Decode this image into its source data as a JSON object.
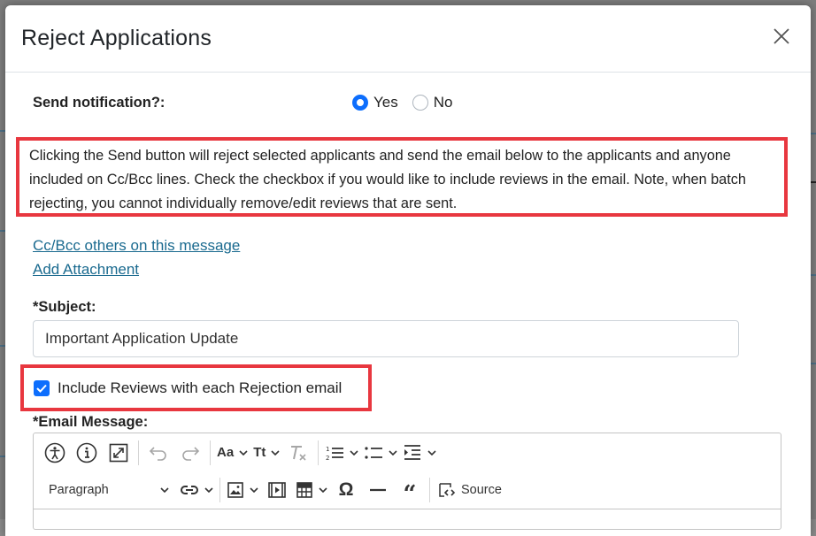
{
  "dialog": {
    "title": "Reject Applications"
  },
  "notification": {
    "label": "Send notification?:",
    "options": [
      {
        "label": "Yes",
        "checked": true
      },
      {
        "label": "No",
        "checked": false
      }
    ]
  },
  "info_text": "Clicking the Send button will reject selected applicants and send the email below to the applicants and anyone included on Cc/Bcc lines. Check the checkbox if you would like to include reviews in the email. Note, when batch rejecting, you cannot individually remove/edit reviews that are sent.",
  "links": {
    "cc_bcc": "Cc/Bcc others on this message",
    "attachment": "Add Attachment"
  },
  "subject": {
    "label": "*Subject:",
    "value": "Important Application Update"
  },
  "reviews_checkbox": {
    "label": "Include Reviews with each Rejection email",
    "checked": true
  },
  "email_message": {
    "label": "*Email Message:"
  },
  "editor_toolbar": {
    "row1": [
      "accessibility-icon",
      "info-icon",
      "fullscreen-icon",
      "undo-icon",
      "redo-icon",
      "font-family-icon",
      "font-size-icon",
      "remove-format-icon",
      "numbered-list-icon",
      "bulleted-list-icon",
      "indent-icon"
    ],
    "font_family_glyph": "Aa",
    "font_size_glyph": "Tt",
    "heading_select": "Paragraph",
    "source_label": "Source"
  },
  "colors": {
    "accent": "#0d6efd",
    "highlight_border": "#e8373f",
    "link": "#1a6a8f"
  }
}
